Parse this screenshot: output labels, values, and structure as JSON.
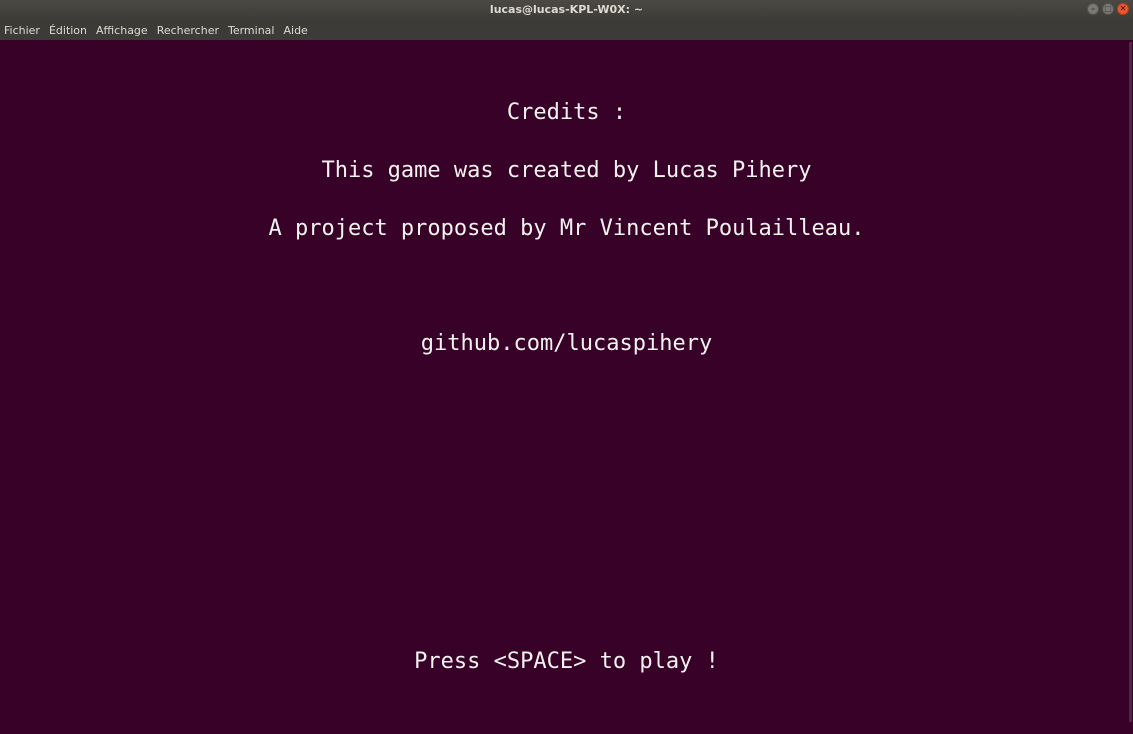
{
  "window": {
    "title": "lucas@lucas-KPL-W0X: ~"
  },
  "menubar": {
    "items": [
      {
        "label": "Fichier"
      },
      {
        "label": "Édition"
      },
      {
        "label": "Affichage"
      },
      {
        "label": "Rechercher"
      },
      {
        "label": "Terminal"
      },
      {
        "label": "Aide"
      }
    ]
  },
  "terminal": {
    "credits_heading": "Credits :",
    "creator_line": "This game was created by Lucas Pihery",
    "proposal_line": "A project proposed by Mr Vincent Poulailleau.",
    "github_link": "github.com/lucaspihery",
    "prompt_line": "Press <SPACE> to play !"
  },
  "colors": {
    "terminal_bg": "#380127",
    "terminal_fg": "#f2f2ee",
    "titlebar_bg": "#3c3b37",
    "close_button": "#e8592e"
  }
}
